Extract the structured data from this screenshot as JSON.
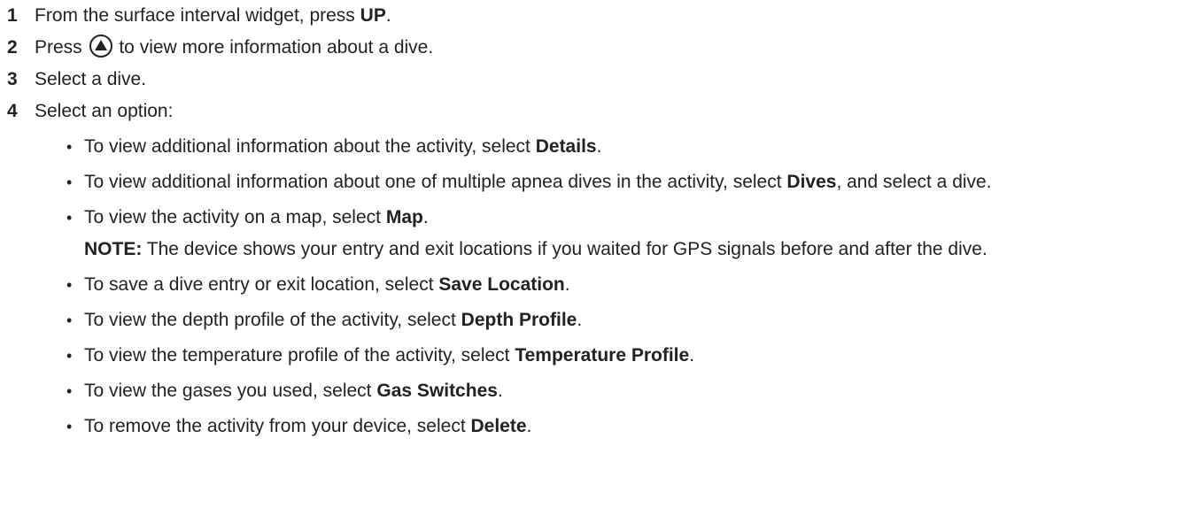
{
  "steps": [
    {
      "num": "1",
      "pre": "From the surface interval widget, press ",
      "bold": "UP",
      "post": "."
    },
    {
      "num": "2",
      "pre": "Press ",
      "icon": "up-arrow-button-icon",
      "post": " to view more information about a dive."
    },
    {
      "num": "3",
      "text": "Select a dive."
    },
    {
      "num": "4",
      "text": "Select an option:"
    }
  ],
  "options": [
    {
      "pre": "To view additional information about the activity, select ",
      "bold": "Details",
      "post": "."
    },
    {
      "pre": "To view additional information about one of multiple apnea dives in the activity, select ",
      "bold": "Dives",
      "post": ", and select a dive."
    },
    {
      "pre": "To view the activity on a map, select ",
      "bold": "Map",
      "post": ".",
      "note_label": "NOTE:",
      "note_text": " The device shows your entry and exit locations if you waited for GPS signals before and after the dive."
    },
    {
      "pre": "To save a dive entry or exit location, select ",
      "bold": "Save Location",
      "post": "."
    },
    {
      "pre": "To view the depth profile of the activity, select ",
      "bold": "Depth Profile",
      "post": "."
    },
    {
      "pre": "To view the temperature profile of the activity, select ",
      "bold": "Temperature Profile",
      "post": "."
    },
    {
      "pre": "To view the gases you used, select ",
      "bold": "Gas Switches",
      "post": "."
    },
    {
      "pre": "To remove the activity from your device, select ",
      "bold": "Delete",
      "post": "."
    }
  ],
  "bullet": "•"
}
